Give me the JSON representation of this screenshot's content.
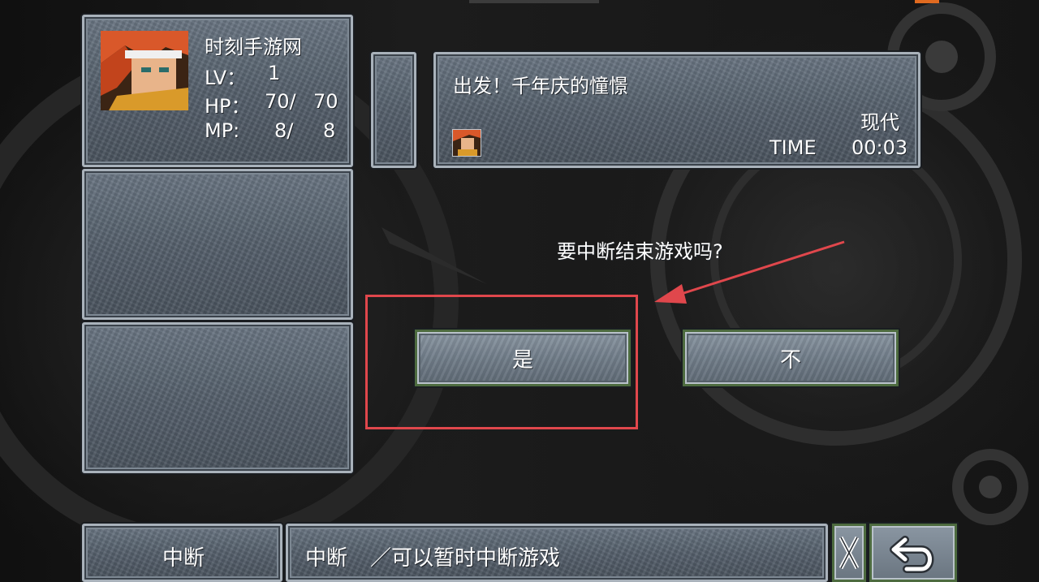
{
  "party_slot_1": {
    "name": "时刻手游网",
    "lv_label": "LV：",
    "lv_value": "1",
    "hp_label": "HP：",
    "hp_value": "70/",
    "hp_max": "70",
    "mp_label": "MP:",
    "mp_value": "8/",
    "mp_max": "8"
  },
  "save_info": {
    "chapter_title": "出发！千年庆的憧憬",
    "era": "现代",
    "time_label": "TIME",
    "time_value": "00:03"
  },
  "dialog": {
    "question": "要中断结束游戏吗?",
    "yes_label": "是",
    "no_label": "不"
  },
  "bottom_bar": {
    "suspend_button_label": "中断",
    "help_title": "中断",
    "help_text": "／可以暂时中断游戏",
    "close_icon": "x-icon",
    "back_icon": "return-arrow-icon"
  },
  "annotation": {
    "highlight_color": "#e0474c",
    "arrow_color": "#e0474c"
  }
}
